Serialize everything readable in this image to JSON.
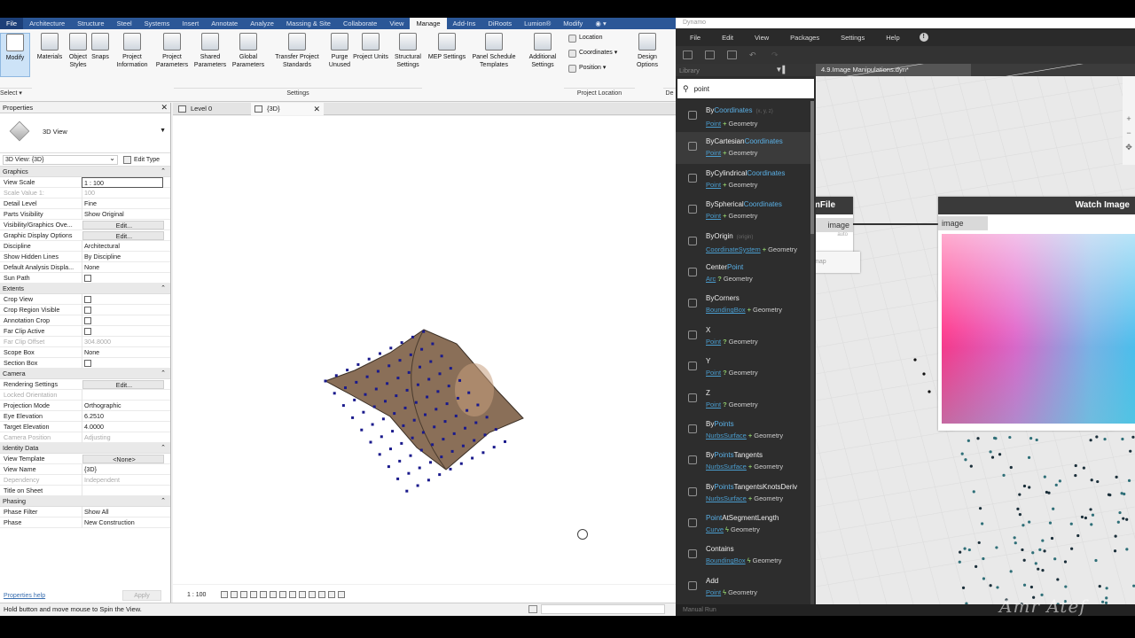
{
  "revit": {
    "menu": [
      "File",
      "Architecture",
      "Structure",
      "Steel",
      "Systems",
      "Insert",
      "Annotate",
      "Analyze",
      "Massing & Site",
      "Collaborate",
      "View",
      "Manage",
      "Add-Ins",
      "DiRoots",
      "Lumion®",
      "Modify",
      "◉ ▾"
    ],
    "active_menu": "Manage",
    "ribbon_buttons": [
      {
        "label": "Modify",
        "icon": "cursor-icon"
      },
      {
        "label": "Materials",
        "icon": "sphere-icon"
      },
      {
        "label": "Object Styles",
        "icon": "styles-icon"
      },
      {
        "label": "Snaps",
        "icon": "magnet-icon"
      },
      {
        "label": "Project Information",
        "icon": "info-icon"
      },
      {
        "label": "Project Parameters",
        "icon": "parameters-icon"
      },
      {
        "label": "Shared Parameters",
        "icon": "shared-parameters-icon"
      },
      {
        "label": "Global Parameters",
        "icon": "globe-icon"
      },
      {
        "label": "Transfer Project Standards",
        "icon": "transfer-icon"
      },
      {
        "label": "Purge Unused",
        "icon": "purge-icon"
      },
      {
        "label": "Project Units",
        "icon": "units-icon"
      },
      {
        "label": "Structural Settings",
        "icon": "structural-icon"
      },
      {
        "label": "MEP Settings",
        "icon": "mep-icon"
      },
      {
        "label": "Panel Schedule Templates",
        "icon": "schedule-icon"
      },
      {
        "label": "Additional Settings",
        "icon": "wrench-icon"
      }
    ],
    "location_items": [
      "Location",
      "Coordinates ▾",
      "Position ▾"
    ],
    "design_options": "Design Options",
    "groups": {
      "select": "Select ▾",
      "settings": "Settings",
      "project_location": "Project Location",
      "de": "De"
    },
    "properties": {
      "title": "Properties",
      "type_name": "3D View",
      "selector": "3D View: {3D}",
      "edit_type": "Edit Type",
      "sections": [
        {
          "name": "Graphics",
          "rows": [
            {
              "k": "View Scale",
              "v": "1 : 100",
              "style": "box"
            },
            {
              "k": "Scale Value    1:",
              "v": "100",
              "dim": true
            },
            {
              "k": "Detail Level",
              "v": "Fine"
            },
            {
              "k": "Parts Visibility",
              "v": "Show Original"
            },
            {
              "k": "Visibility/Graphics Ove...",
              "v": "Edit...",
              "style": "btn"
            },
            {
              "k": "Graphic Display Options",
              "v": "Edit...",
              "style": "btn"
            },
            {
              "k": "Discipline",
              "v": "Architectural"
            },
            {
              "k": "Show Hidden Lines",
              "v": "By Discipline"
            },
            {
              "k": "Default Analysis Displa...",
              "v": "None"
            },
            {
              "k": "Sun Path",
              "v": "",
              "style": "cb"
            }
          ]
        },
        {
          "name": "Extents",
          "rows": [
            {
              "k": "Crop View",
              "v": "",
              "style": "cb"
            },
            {
              "k": "Crop Region Visible",
              "v": "",
              "style": "cb"
            },
            {
              "k": "Annotation Crop",
              "v": "",
              "style": "cb"
            },
            {
              "k": "Far Clip Active",
              "v": "",
              "style": "cb"
            },
            {
              "k": "Far Clip Offset",
              "v": "304.8000",
              "dim": true
            },
            {
              "k": "Scope Box",
              "v": "None"
            },
            {
              "k": "Section Box",
              "v": "",
              "style": "cb"
            }
          ]
        },
        {
          "name": "Camera",
          "rows": [
            {
              "k": "Rendering Settings",
              "v": "Edit...",
              "style": "btn"
            },
            {
              "k": "Locked Orientation",
              "v": "",
              "dim": true
            },
            {
              "k": "Projection Mode",
              "v": "Orthographic"
            },
            {
              "k": "Eye Elevation",
              "v": "6.2510"
            },
            {
              "k": "Target Elevation",
              "v": "4.0000"
            },
            {
              "k": "Camera Position",
              "v": "Adjusting",
              "dim": true
            }
          ]
        },
        {
          "name": "Identity Data",
          "rows": [
            {
              "k": "View Template",
              "v": "<None>",
              "style": "btn"
            },
            {
              "k": "View Name",
              "v": "{3D}"
            },
            {
              "k": "Dependency",
              "v": "Independent",
              "dim": true
            },
            {
              "k": "Title on Sheet",
              "v": ""
            }
          ]
        },
        {
          "name": "Phasing",
          "rows": [
            {
              "k": "Phase Filter",
              "v": "Show All"
            },
            {
              "k": "Phase",
              "v": "New Construction"
            }
          ]
        }
      ],
      "help": "Properties help",
      "apply": "Apply"
    },
    "view_tabs": [
      {
        "label": "Level 0"
      },
      {
        "label": "{3D}",
        "active": true
      }
    ],
    "view_scale": "1 : 100",
    "status": "Hold button and move mouse to Spin the View."
  },
  "dynamo": {
    "title": "Dynamo",
    "menu": [
      "File",
      "Edit",
      "View",
      "Packages",
      "Settings",
      "Help"
    ],
    "help_icon": "!",
    "library_label": "Library",
    "search": "point",
    "file_tab": "4.9.Image Manipulations.dyn*",
    "library_items": [
      {
        "name": [
          "By",
          "Coordinates",
          ""
        ],
        "sub": [
          "Point",
          "+",
          "Geometry"
        ],
        "hint": "(x, y, z)"
      },
      {
        "name": [
          "ByCartesian",
          "Coordinates",
          ""
        ],
        "sub": [
          "Point",
          "+",
          "Geometry"
        ]
      },
      {
        "name": [
          "ByCylindrical",
          "Coordinates",
          ""
        ],
        "sub": [
          "Point",
          "+",
          "Geometry"
        ]
      },
      {
        "name": [
          "BySpherical",
          "Coordinates",
          ""
        ],
        "sub": [
          "Point",
          "+",
          "Geometry"
        ]
      },
      {
        "name": [
          "ByOrigin",
          "",
          ""
        ],
        "sub": [
          "CoordinateSystem",
          "+",
          "Geometry"
        ],
        "hint": "(origin)"
      },
      {
        "name": [
          "Center",
          "Point",
          ""
        ],
        "sub": [
          "Arc",
          "?",
          "Geometry"
        ]
      },
      {
        "name": [
          "ByCorners",
          "",
          ""
        ],
        "sub": [
          "BoundingBox",
          "+",
          "Geometry"
        ]
      },
      {
        "name": [
          "X",
          "",
          ""
        ],
        "sub": [
          "Point",
          "?",
          "Geometry"
        ]
      },
      {
        "name": [
          "Y",
          "",
          ""
        ],
        "sub": [
          "Point",
          "?",
          "Geometry"
        ]
      },
      {
        "name": [
          "Z",
          "",
          ""
        ],
        "sub": [
          "Point",
          "?",
          "Geometry"
        ]
      },
      {
        "name": [
          "By",
          "Points",
          ""
        ],
        "sub": [
          "NurbsSurface",
          "+",
          "Geometry"
        ]
      },
      {
        "name": [
          "By",
          "Points",
          "Tangents"
        ],
        "sub": [
          "NurbsSurface",
          "+",
          "Geometry"
        ]
      },
      {
        "name": [
          "By",
          "Points",
          "TangentsKnotsDeriv"
        ],
        "sub": [
          "NurbsSurface",
          "+",
          "Geometry"
        ]
      },
      {
        "name": [
          "",
          "Point",
          "AtSegmentLength"
        ],
        "sub": [
          "Curve",
          "ϟ",
          "Geometry"
        ]
      },
      {
        "name": [
          "Contains",
          "",
          ""
        ],
        "sub": [
          "BoundingBox",
          "ϟ",
          "Geometry"
        ]
      },
      {
        "name": [
          "Add",
          "",
          ""
        ],
        "sub": [
          "Point",
          "ϟ",
          "Geometry"
        ]
      }
    ],
    "node_file": {
      "title": "mFile",
      "port_out": "image",
      "hint": "auto"
    },
    "node_map": "map",
    "watch_node": {
      "title": "Watch Image",
      "port_in": "image"
    },
    "bottom": "Manual          Run"
  },
  "watermark": "Amr Atef"
}
